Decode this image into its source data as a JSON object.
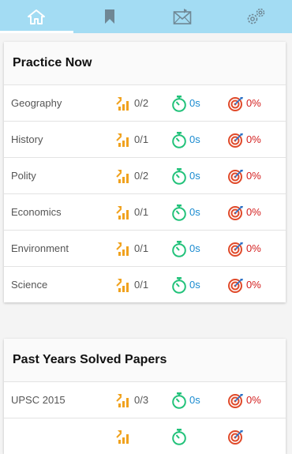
{
  "tabs": [
    {
      "id": "home",
      "icon": "home-icon",
      "active": true
    },
    {
      "id": "bookmarks",
      "icon": "bookmark-icon",
      "active": false
    },
    {
      "id": "messages",
      "icon": "envelope-icon",
      "active": false
    },
    {
      "id": "settings",
      "icon": "gears-icon",
      "active": false
    }
  ],
  "colors": {
    "tabbar_bg": "#a3dcf3",
    "attempt_icon": "#f0a21e",
    "time_icon": "#22c27a",
    "time_text": "#1a8bd0",
    "accuracy_text": "#d42020"
  },
  "practice": {
    "title": "Practice Now",
    "rows": [
      {
        "subject": "Geography",
        "attempted": "0/2",
        "time": "0s",
        "accuracy": "0%"
      },
      {
        "subject": "History",
        "attempted": "0/1",
        "time": "0s",
        "accuracy": "0%"
      },
      {
        "subject": "Polity",
        "attempted": "0/2",
        "time": "0s",
        "accuracy": "0%"
      },
      {
        "subject": "Economics",
        "attempted": "0/1",
        "time": "0s",
        "accuracy": "0%"
      },
      {
        "subject": "Environment",
        "attempted": "0/1",
        "time": "0s",
        "accuracy": "0%"
      },
      {
        "subject": "Science",
        "attempted": "0/1",
        "time": "0s",
        "accuracy": "0%"
      }
    ]
  },
  "papers": {
    "title": "Past Years Solved Papers",
    "rows": [
      {
        "subject": "UPSC 2015",
        "attempted": "0/3",
        "time": "0s",
        "accuracy": "0%"
      },
      {
        "subject": "",
        "attempted": "",
        "time": "",
        "accuracy": ""
      }
    ]
  }
}
